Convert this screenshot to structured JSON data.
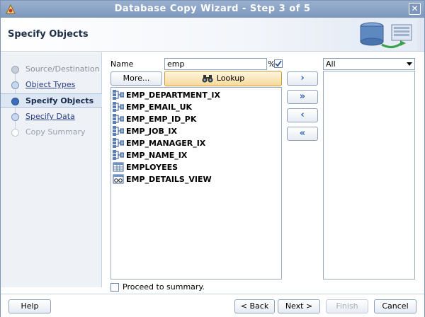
{
  "window": {
    "title": "Database Copy Wizard - Step 3 of 5",
    "close_glyph": "✕"
  },
  "header": {
    "page_title": "Specify Objects"
  },
  "nav": {
    "items": [
      {
        "label": "Source/Destination",
        "state": "done"
      },
      {
        "label": "Object Types",
        "state": "link"
      },
      {
        "label": "Specify Objects",
        "state": "current"
      },
      {
        "label": "Specify Data",
        "state": "link"
      },
      {
        "label": "Copy Summary",
        "state": "disabled"
      }
    ]
  },
  "search": {
    "name_label": "Name",
    "name_value": "emp",
    "wildcard_symbol": "%",
    "wildcard_checked": true,
    "more_label": "More...",
    "lookup_label": "Lookup"
  },
  "objects": [
    {
      "name": "EMP_DEPARTMENT_IX",
      "icon": "index-icon"
    },
    {
      "name": "EMP_EMAIL_UK",
      "icon": "index-icon"
    },
    {
      "name": "EMP_EMP_ID_PK",
      "icon": "index-icon"
    },
    {
      "name": "EMP_JOB_IX",
      "icon": "index-icon"
    },
    {
      "name": "EMP_MANAGER_IX",
      "icon": "index-icon"
    },
    {
      "name": "EMP_NAME_IX",
      "icon": "index-icon"
    },
    {
      "name": "EMPLOYEES",
      "icon": "table-icon"
    },
    {
      "name": "EMP_DETAILS_VIEW",
      "icon": "view-icon"
    }
  ],
  "move_buttons": {
    "add": "›",
    "add_all": "»",
    "remove": "‹",
    "remove_all": "«"
  },
  "filter": {
    "selected": "All"
  },
  "proceed": {
    "label": "Proceed to summary.",
    "checked": false
  },
  "footer": {
    "help": "Help",
    "back": "< Back",
    "next": "Next >",
    "finish": "Finish",
    "cancel": "Cancel"
  },
  "colors": {
    "titlebar": "#7d97bd",
    "accent": "#3d6fb8",
    "lookup": "#f5d999"
  }
}
